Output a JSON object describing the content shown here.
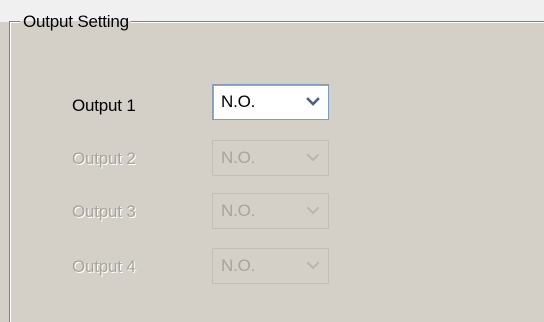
{
  "group": {
    "title": "Output Setting"
  },
  "outputs": [
    {
      "label": "Output 1",
      "value": "N.O.",
      "enabled": true
    },
    {
      "label": "Output 2",
      "value": "N.O.",
      "enabled": false
    },
    {
      "label": "Output 3",
      "value": "N.O.",
      "enabled": false
    },
    {
      "label": "Output 4",
      "value": "N.O.",
      "enabled": false
    }
  ],
  "icons": {
    "dropdown": "chevron-down-icon"
  },
  "colors": {
    "enabled_text": "#000000",
    "disabled_text": "#a8a49c",
    "panel_background": "#d4d0c8"
  }
}
